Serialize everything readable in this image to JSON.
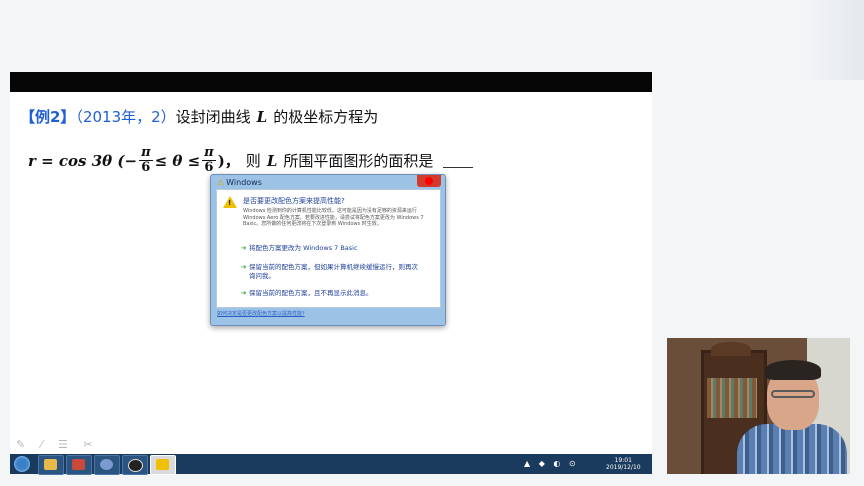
{
  "slide": {
    "q_tag": "【例2】",
    "q_year": "（2013年，2）",
    "q_text1": "设封闭曲线",
    "q_var": "L",
    "q_text2": "的极坐标方程为",
    "f_lhs": "r = cos 3θ (−",
    "f_pi": "π",
    "f_six": "6",
    "f_mid": "≤ θ ≤",
    "f_close": ")，",
    "f_then": "则",
    "f_var": "L",
    "f_rest": "所围平面图形的面积是",
    "tools": "✎ ⁄ ☰ ✂"
  },
  "dialog": {
    "title": "Windows",
    "heading": "是否要更改配色方案来提高性能?",
    "description": "Windows 检测到你的计算机性能比较低。这可能是因为没有足够的资源来运行 Windows Aero 配色方案。若要改进性能，请尝试将配色方案更改为 Windows 7 Basic。您所做的任何更改将在下次登录到 Windows 时生效。",
    "options": [
      "将配色方案更改为 Windows 7 Basic",
      "保留当前的配色方案，但如果计算机继续缓慢运行，则再次询问我。",
      "保留当前的配色方案，且不再显示此消息。"
    ],
    "footer_link": "如何决定是否更改配色方案以提高性能?"
  },
  "taskbar": {
    "tray_icons": "▲ ◆ ◐ ⊙",
    "time": "19:01",
    "date": "2019/12/10"
  },
  "colors": {
    "accent": "#1f5fd6",
    "taskbar": "#1b3b5e",
    "dialog_frame": "#9cc2e6",
    "close_red": "#d23a2b"
  }
}
